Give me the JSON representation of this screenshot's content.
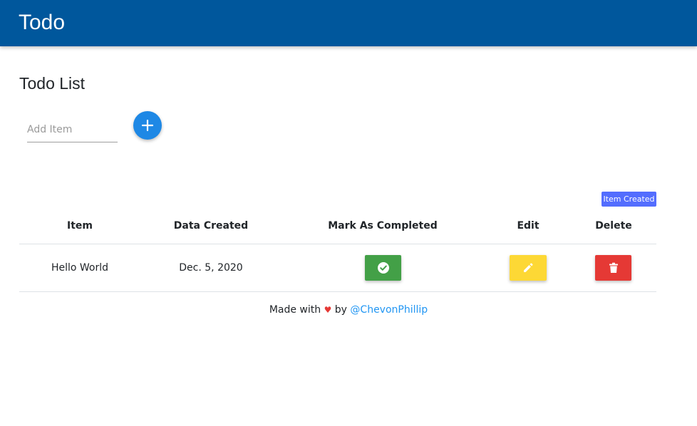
{
  "navbar": {
    "brand": "Todo"
  },
  "page": {
    "title": "Todo List"
  },
  "add_form": {
    "placeholder": "Add Item",
    "value": ""
  },
  "toast": {
    "text": "Item Created",
    "color": "#536dfe"
  },
  "table": {
    "headers": [
      "Item",
      "Data Created",
      "Mark As Completed",
      "Edit",
      "Delete"
    ],
    "rows": [
      {
        "item": "Hello World",
        "date": "Dec. 5, 2020"
      }
    ]
  },
  "footer": {
    "prefix": "Made with",
    "heart": "♥",
    "by": "by",
    "author": "@ChevonPhillip"
  },
  "icons": {
    "add": "plus-icon",
    "complete": "check-circle-icon",
    "edit": "pencil-icon",
    "delete": "trash-icon"
  },
  "colors": {
    "navbar": "#00579c",
    "add_button": "#1e88e5",
    "complete": "#43a047",
    "edit": "#fdd835",
    "delete": "#e53935",
    "link": "#2196f3"
  }
}
